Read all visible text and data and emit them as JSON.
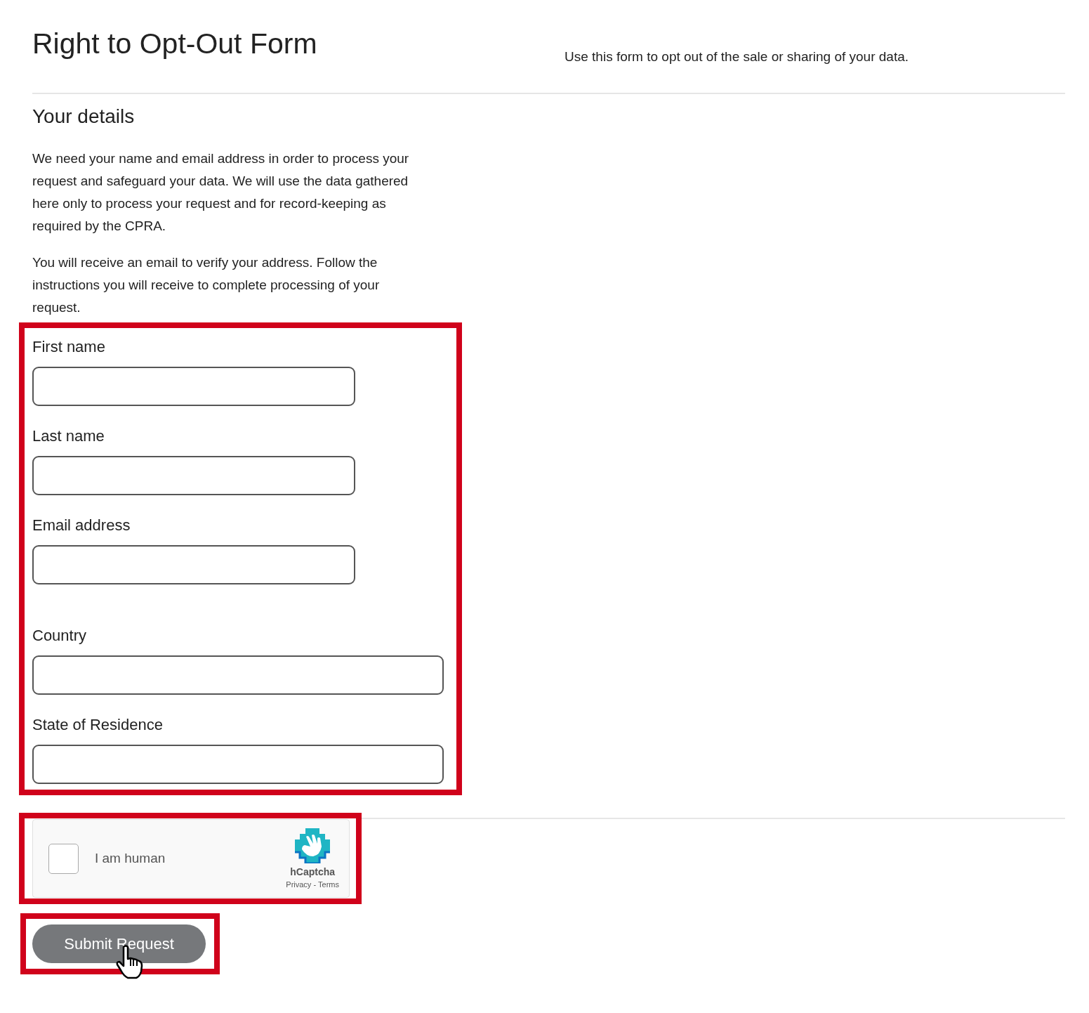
{
  "header": {
    "title": "Right to Opt-Out Form",
    "description": "Use this form to opt out of the sale or sharing of your data."
  },
  "section": {
    "heading": "Your details",
    "paragraphs": [
      "We need your name and email address in order to process your request and safeguard your data. We will use the data gathered here only to process your request and for record-keeping as required by the CPRA.",
      "You will receive an email to verify your address. Follow the instructions you will receive to complete processing of your request."
    ]
  },
  "form": {
    "highlighted": true,
    "fields": [
      {
        "label": "First name",
        "kind": "short"
      },
      {
        "label": "Last name",
        "kind": "short"
      },
      {
        "label": "Email address",
        "kind": "short"
      },
      {
        "label": "Country",
        "kind": "wide"
      },
      {
        "label": "State of Residence",
        "kind": "wide"
      }
    ]
  },
  "captcha": {
    "highlighted": true,
    "checked": false,
    "label": "I am human",
    "brand": "hCaptcha",
    "links": [
      "Privacy",
      "-",
      "Terms"
    ]
  },
  "submit": {
    "highlighted": true,
    "label": "Submit Request"
  }
}
